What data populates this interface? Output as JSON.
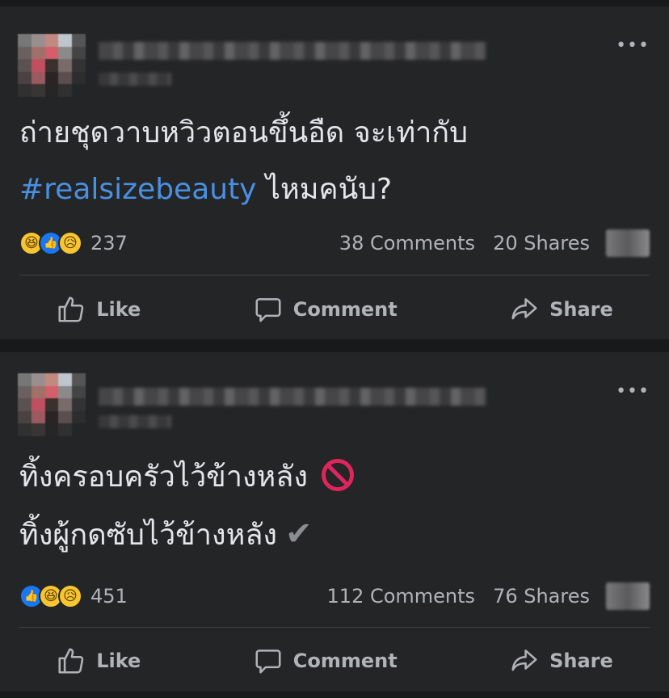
{
  "posts": [
    {
      "text_line1": "ถ่ายชุดวาบหวิวตอนขึ้นอืด จะเท่ากับ",
      "hashtag": "#realsizebeauty",
      "text_line2_rest": " ไหมคนับ?",
      "reaction_icons": [
        "haha-icon",
        "like-icon",
        "sad-icon"
      ],
      "reaction_count": "237",
      "comments": "38 Comments",
      "shares": "20 Shares"
    },
    {
      "text_line1": "ทิ้งครอบครัวไว้ข้างหลัง",
      "text_line1_emoji": "no-entry-icon",
      "text_line2": "ทิ้งผู้กดซับไว้ข้างหลัง",
      "text_line2_emoji": "check-mark-icon",
      "check_glyph": "✔",
      "reaction_icons": [
        "like-icon",
        "haha-icon",
        "sad-icon"
      ],
      "reaction_count": "451",
      "comments": "112 Comments",
      "shares": "76 Shares"
    }
  ],
  "actions": {
    "like": "Like",
    "comment": "Comment",
    "share": "Share"
  },
  "more_glyph": "•••",
  "colors": {
    "background": "#18191a",
    "card": "#242526",
    "text": "#e4e6eb",
    "secondary_text": "#b0b3b8",
    "hashtag": "#4a90e2",
    "like_blue": "#1877f2",
    "emoji_yellow": "#f7c531",
    "no_entry_red": "#e0245e"
  }
}
